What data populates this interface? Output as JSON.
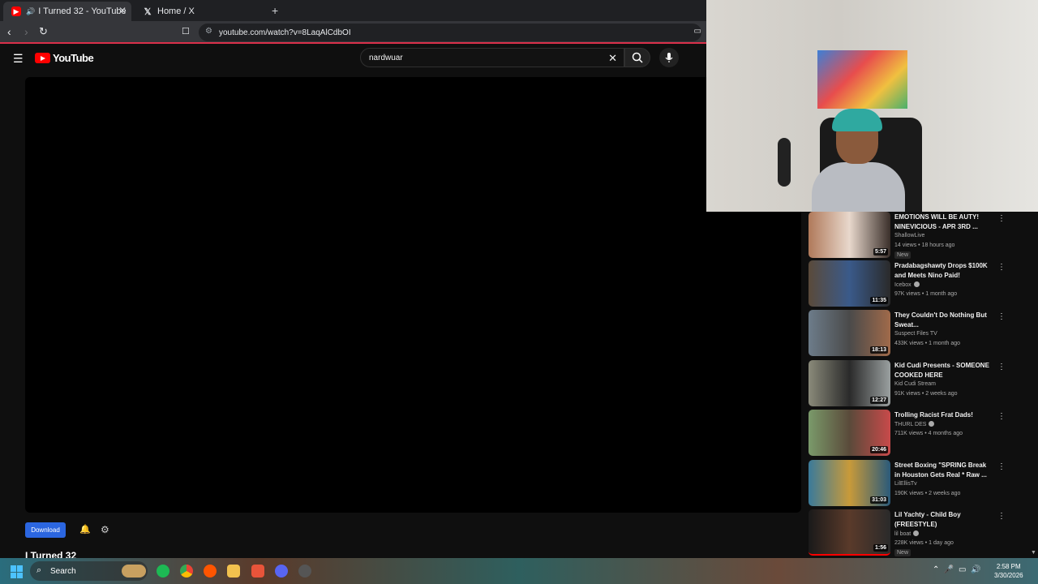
{
  "browser": {
    "tabs": [
      {
        "title": "I Turned 32 - YouTube",
        "active": true
      },
      {
        "title": "Home / X",
        "active": false
      }
    ],
    "new_tab_label": "+",
    "url": "youtube.com/watch?v=8LaqAlCdbOI"
  },
  "youtube": {
    "logo_text": "YouTube",
    "search_value": "nardwuar",
    "download_label": "Download",
    "video_title": "I Turned 32"
  },
  "recommendations": [
    {
      "title": "EMOTIONS WILL BE AUTY! NINEVICIOUS - APR 3RD ...",
      "channel": "ShallowLive",
      "meta": "14 views • 18 hours ago",
      "badge": "New",
      "duration": "5:57",
      "verified": false
    },
    {
      "title": "Pradabagshawty Drops $100K and Meets Nino Paid!",
      "channel": "Icebox",
      "meta": "97K views • 1 month ago",
      "badge": "",
      "duration": "11:35",
      "verified": true
    },
    {
      "title": "They Couldn't Do Nothing But Sweat...",
      "channel": "Suspect Files TV",
      "meta": "433K views • 1 month ago",
      "badge": "",
      "duration": "18:13",
      "verified": false
    },
    {
      "title": "Kid Cudi Presents - SOMEONE COOKED HERE",
      "channel": "Kid Cudi Stream",
      "meta": "91K views • 2 weeks ago",
      "badge": "",
      "duration": "12:27",
      "verified": false
    },
    {
      "title": "Trolling Racist Frat Dads!",
      "channel": "THURL DES",
      "meta": "711K views • 4 months ago",
      "badge": "",
      "duration": "20:46",
      "verified": true
    },
    {
      "title": "Street Boxing \"SPRING Break in Houston Gets Real * Raw ...",
      "channel": "LilEllisTv",
      "meta": "190K views • 2 weeks ago",
      "badge": "",
      "duration": "31:03",
      "verified": false
    },
    {
      "title": "Lil Yachty - Child Boy (FREESTYLE)",
      "channel": "lil boat",
      "meta": "228K views • 1 day ago",
      "badge": "New",
      "duration": "1:56",
      "verified": true
    }
  ],
  "taskbar": {
    "search_label": "Search",
    "time": "2:58 PM",
    "date": "3/30/2026"
  },
  "colors": {
    "accent_red": "#ff0000",
    "download_blue": "#2b66e0",
    "tab_indicator": "#d9304a"
  }
}
